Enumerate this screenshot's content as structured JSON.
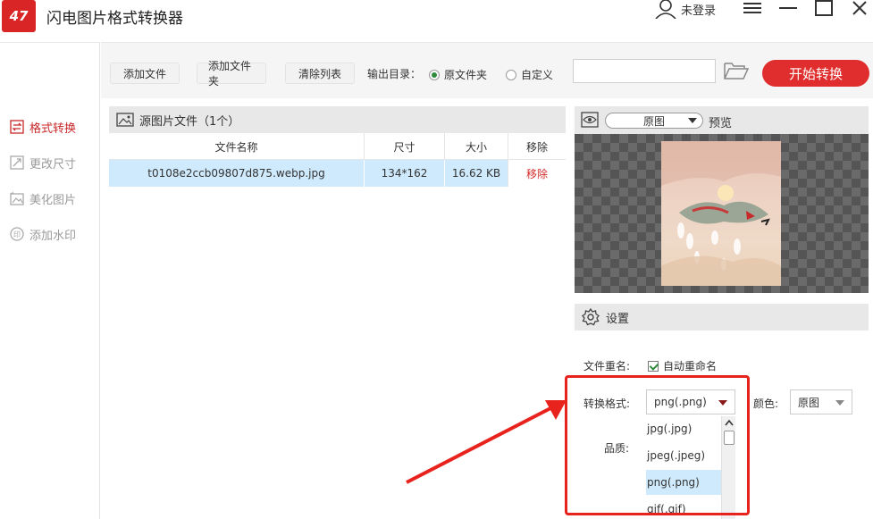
{
  "app": {
    "logo_text": "47",
    "title": "闪电图片格式转换器",
    "user_label": "未登录"
  },
  "sidebar": {
    "items": [
      {
        "label": "格式转换",
        "icon": "swap-icon",
        "active": true
      },
      {
        "label": "更改尺寸",
        "icon": "resize-icon",
        "active": false
      },
      {
        "label": "美化图片",
        "icon": "beautify-icon",
        "active": false
      },
      {
        "label": "添加水印",
        "icon": "watermark-icon",
        "active": false
      }
    ]
  },
  "toolbar": {
    "add_file": "添加文件",
    "add_folder": "添加文件夹",
    "clear_list": "清除列表",
    "output_label": "输出目录：",
    "radio_original": "原文件夹",
    "radio_custom": "自定义",
    "output_path": "",
    "start": "开始转换"
  },
  "file_panel": {
    "title": "源图片文件（1个）",
    "columns": [
      "文件名称",
      "尺寸",
      "大小",
      "移除"
    ],
    "rows": [
      {
        "name": "t0108e2ccb09807d875.webp.jpg",
        "dimensions": "134*162",
        "size": "16.62 KB",
        "remove": "移除"
      }
    ]
  },
  "preview": {
    "mode": "原图",
    "label": "预览"
  },
  "settings": {
    "title": "设置",
    "rename_label": "文件重名:",
    "auto_rename": "自动重命名",
    "format_label": "转换格式:",
    "format_value": "png(.png)",
    "color_label": "颜色:",
    "color_value": "原图",
    "quality_label": "品质:",
    "format_options": [
      "jpg(.jpg)",
      "jpeg(.jpeg)",
      "png(.png)",
      "gif(.gif)"
    ],
    "selected_option": "png(.png)"
  },
  "colors": {
    "accent": "#e02d2d",
    "selection": "#cfeafc",
    "annotation": "#e8221c"
  }
}
